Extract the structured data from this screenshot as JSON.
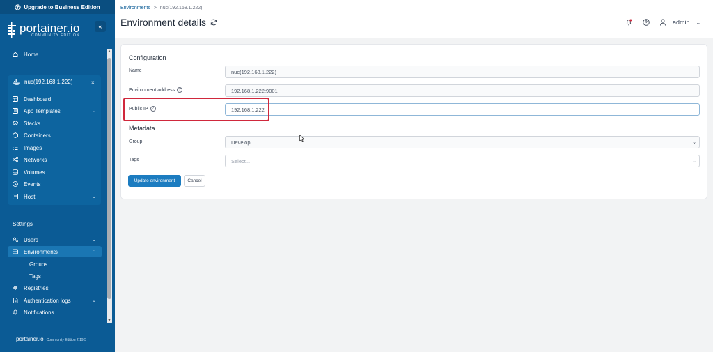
{
  "sidebar": {
    "upgrade_label": "Upgrade to Business Edition",
    "brand_name": "portainer.io",
    "brand_sub": "COMMUNITY EDITION",
    "home_label": "Home",
    "environment": {
      "name": "nuc(192.168.1.222)",
      "items": [
        {
          "label": "Dashboard",
          "icon": "dashboard-icon"
        },
        {
          "label": "App Templates",
          "icon": "templates-icon",
          "expandable": true
        },
        {
          "label": "Stacks",
          "icon": "stacks-icon"
        },
        {
          "label": "Containers",
          "icon": "containers-icon"
        },
        {
          "label": "Images",
          "icon": "images-icon"
        },
        {
          "label": "Networks",
          "icon": "networks-icon"
        },
        {
          "label": "Volumes",
          "icon": "volumes-icon"
        },
        {
          "label": "Events",
          "icon": "events-icon"
        },
        {
          "label": "Host",
          "icon": "host-icon",
          "expandable": true
        }
      ]
    },
    "settings_label": "Settings",
    "settings_items": {
      "users": "Users",
      "environments": "Environments",
      "groups": "Groups",
      "tags": "Tags",
      "registries": "Registries",
      "auth_logs": "Authentication logs",
      "notifications": "Notifications"
    },
    "footer": {
      "brand": "portainer.io",
      "edition": "Community Edition 2.19.5"
    }
  },
  "header": {
    "breadcrumb_root": "Environments",
    "breadcrumb_sep": ">",
    "breadcrumb_current": "nuc(192.168.1.222)",
    "title": "Environment details",
    "user_name": "admin"
  },
  "form": {
    "configuration_heading": "Configuration",
    "name_label": "Name",
    "name_value": "nuc(192.168.1.222)",
    "address_label": "Environment address",
    "address_value": "192.168.1.222:9001",
    "public_ip_label": "Public IP",
    "public_ip_value": "192.168.1.222",
    "metadata_heading": "Metadata",
    "group_label": "Group",
    "group_value": "Develop",
    "tags_label": "Tags",
    "tags_placeholder": "Select...",
    "update_button": "Update environment",
    "cancel_button": "Cancel"
  },
  "colors": {
    "sidebar_bg": "#0b5b95",
    "primary": "#1c7cc0",
    "highlight": "#d0283c"
  }
}
